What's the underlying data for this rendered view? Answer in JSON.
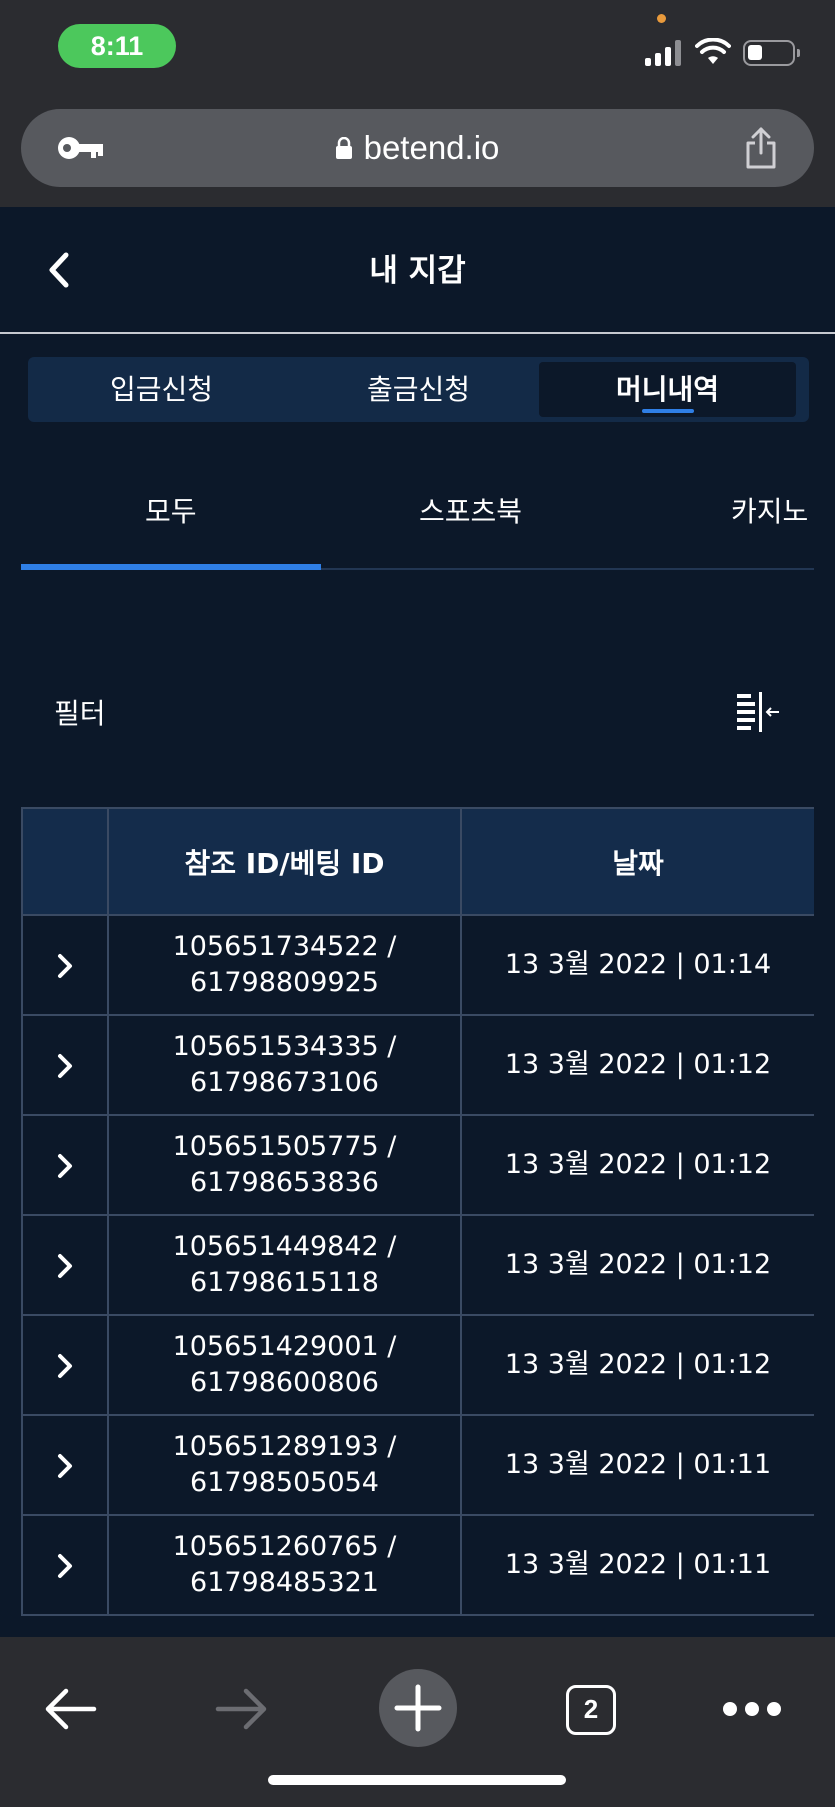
{
  "status_bar": {
    "time": "8:11"
  },
  "browser": {
    "url": "betend.io",
    "open_tabs": "2"
  },
  "header": {
    "title": "내 지갑"
  },
  "segments": [
    {
      "label": "입금신청",
      "active": false
    },
    {
      "label": "출금신청",
      "active": false
    },
    {
      "label": "머니내역",
      "active": true
    }
  ],
  "subtabs": [
    {
      "label": "모두",
      "active": true
    },
    {
      "label": "스포츠북",
      "active": false
    },
    {
      "label": "카지노",
      "active": false
    }
  ],
  "filter": {
    "label": "필터"
  },
  "table": {
    "columns": [
      "",
      "참조 ID/베팅 ID",
      "날짜"
    ],
    "rows": [
      {
        "ref_id": "105651734522 /",
        "bet_id": "61798809925",
        "date": "13 3월 2022 | 01:14"
      },
      {
        "ref_id": "105651534335 /",
        "bet_id": "61798673106",
        "date": "13 3월 2022 | 01:12"
      },
      {
        "ref_id": "105651505775 /",
        "bet_id": "61798653836",
        "date": "13 3월 2022 | 01:12"
      },
      {
        "ref_id": "105651449842 /",
        "bet_id": "61798615118",
        "date": "13 3월 2022 | 01:12"
      },
      {
        "ref_id": "105651429001 /",
        "bet_id": "61798600806",
        "date": "13 3월 2022 | 01:12"
      },
      {
        "ref_id": "105651289193 /",
        "bet_id": "61798505054",
        "date": "13 3월 2022 | 01:11"
      },
      {
        "ref_id": "105651260765 /",
        "bet_id": "61798485321",
        "date": "13 3월 2022 | 01:11"
      }
    ]
  },
  "colors": {
    "background": "#0c1829",
    "accent": "#2f7fe6",
    "header_cell": "#142c4b",
    "chrome": "#2b2c30"
  }
}
